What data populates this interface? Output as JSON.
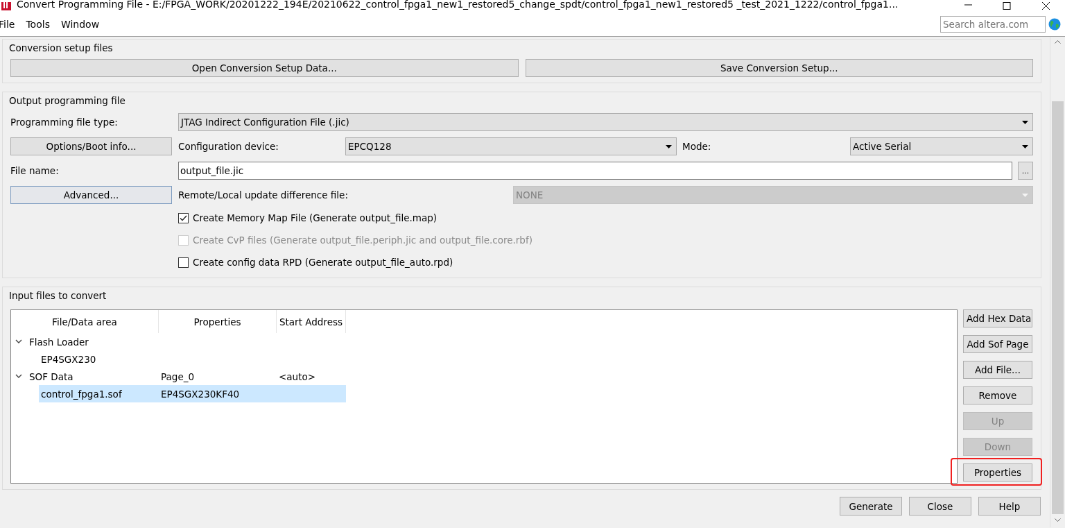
{
  "window": {
    "title": "Convert Programming File - E:/FPGA_WORK/20201222_194E/20210622_control_fpga1_new1_restored5_change_spdt/control_fpga1_new1_restored5 _test_2021_1222/control_fpga1..."
  },
  "menu": [
    "File",
    "Tools",
    "Window"
  ],
  "search": {
    "placeholder": "Search altera.com"
  },
  "conversion_setup": {
    "title": "Conversion setup files",
    "buttons": [
      "Open Conversion Setup Data...",
      "Save Conversion Setup..."
    ]
  },
  "output": {
    "title": "Output programming file",
    "file_type": {
      "label": "Programming file type:",
      "value": "JTAG Indirect Configuration File (.jic)"
    },
    "options_button": "Options/Boot info...",
    "config_device": {
      "label": "Configuration device:",
      "value": "EPCQ128"
    },
    "mode": {
      "label": "Mode:",
      "value": "Active Serial"
    },
    "file_name": {
      "label": "File name:",
      "value": "output_file.jic",
      "browse": "..."
    },
    "advanced_button": "Advanced...",
    "difference_file": {
      "label": "Remote/Local update difference file:",
      "value": "NONE",
      "disabled": true
    },
    "options": [
      {
        "label": "Create Memory Map File (Generate output_file.map)",
        "checked": true,
        "disabled": false
      },
      {
        "label": "Create CvP files (Generate output_file.periph.jic and output_file.core.rbf)",
        "checked": false,
        "disabled": true
      },
      {
        "label": "Create config data RPD (Generate output_file_auto.rpd)",
        "checked": false,
        "disabled": false
      }
    ]
  },
  "input": {
    "title": "Input files to convert",
    "columns": [
      "File/Data area",
      "Properties",
      "Start Address"
    ],
    "tree": [
      {
        "name": "Flash Loader",
        "expanded": true,
        "selected": false,
        "children": [
          {
            "name": "EP4SGX230",
            "selected": false
          }
        ]
      },
      {
        "name": "SOF Data",
        "properties": "Page_0",
        "start_address": "<auto>",
        "expanded": true,
        "selected": false,
        "children": [
          {
            "name": "control_fpga1.sof",
            "properties": "EP4SGX230KF40",
            "selected": true
          }
        ]
      }
    ],
    "buttons": [
      {
        "label": "Add Hex Data",
        "disabled": false,
        "highlighted": false
      },
      {
        "label": "Add Sof Page",
        "disabled": false,
        "highlighted": false
      },
      {
        "label": "Add File...",
        "disabled": false,
        "highlighted": false
      },
      {
        "label": "Remove",
        "disabled": false,
        "highlighted": false
      },
      {
        "label": "Up",
        "disabled": true,
        "highlighted": false
      },
      {
        "label": "Down",
        "disabled": true,
        "highlighted": false
      },
      {
        "label": "Properties",
        "disabled": false,
        "highlighted": true
      }
    ]
  },
  "footer_buttons": [
    "Generate",
    "Close",
    "Help"
  ]
}
